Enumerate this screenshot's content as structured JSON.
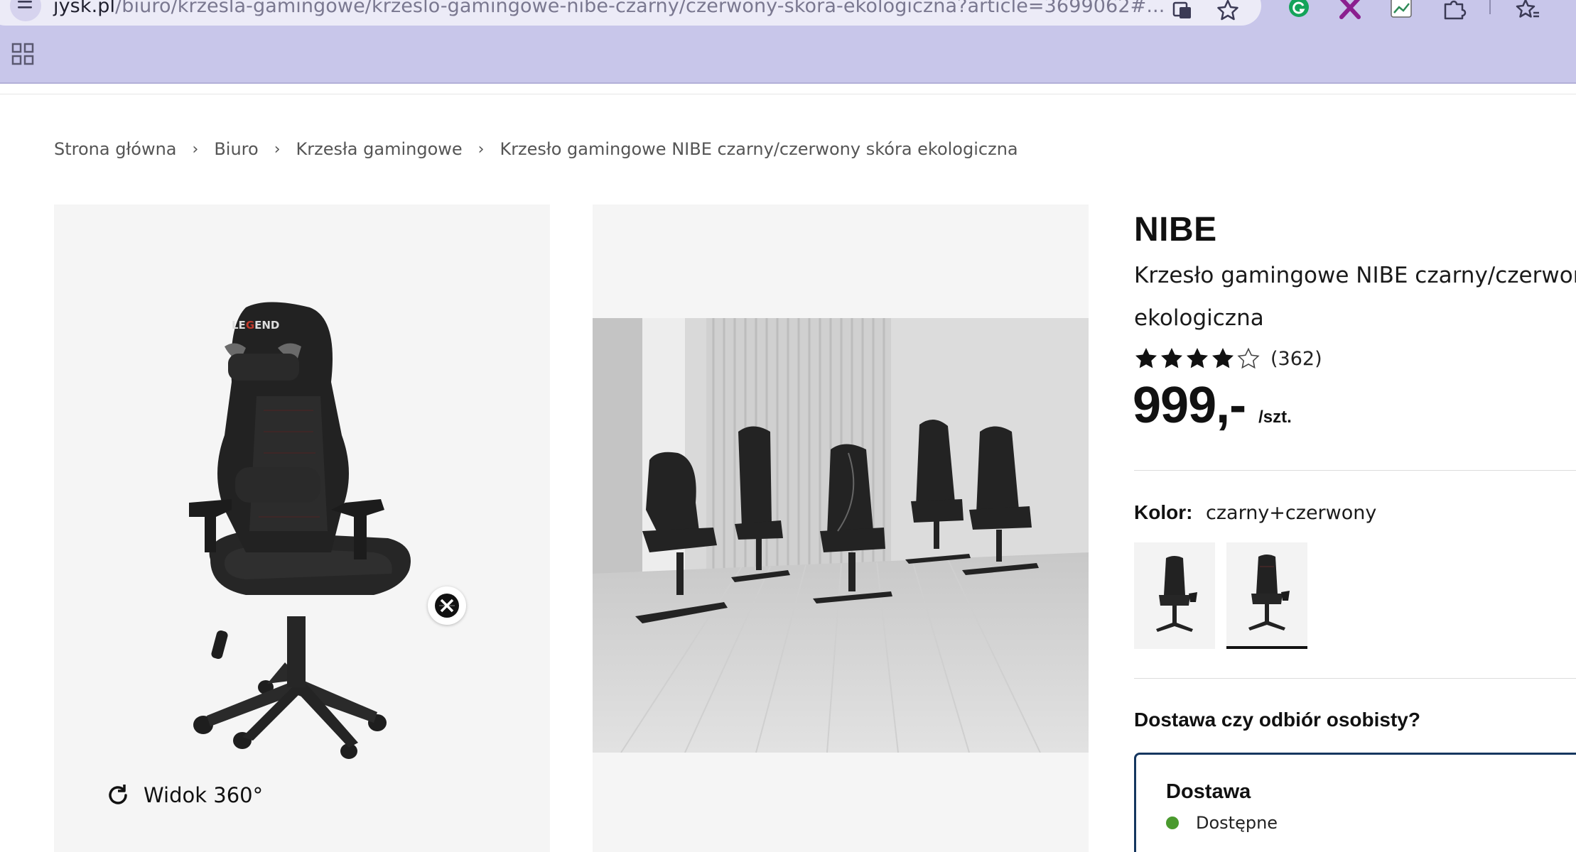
{
  "browser": {
    "url_host": "jysk.pl",
    "url_path": "/biuro/krzesla-gamingowe/krzeslo-gamingowe-nibe-czarny/czerwony-skora-ekologiczna?article=3699062#...",
    "icons": [
      "site-info-icon",
      "translate-icon",
      "bookmark-star-icon",
      "grammarly-icon",
      "x-extension-icon",
      "chart-extension-icon",
      "extensions-puzzle-icon",
      "reading-list-icon",
      "apps-grid-icon"
    ]
  },
  "breadcrumb": [
    "Strona główna",
    "Biuro",
    "Krzesła gamingowe",
    "Krzesło gamingowe NIBE czarny/czerwony skóra ekologiczna"
  ],
  "gallery": {
    "view360_label": "Widok 360°"
  },
  "product": {
    "brand": "NIBE",
    "subtitle_line1": "Krzesło gamingowe NIBE czarny/czerwony",
    "subtitle_line2": "ekologiczna",
    "rating": 4,
    "rating_max": 5,
    "rating_count": "(362)",
    "price": "999,-",
    "price_unit": "/szt.",
    "color_label": "Kolor:",
    "color_value": "czarny+czerwony",
    "delivery_question": "Dostawa czy odbiór osobisty?",
    "delivery_title": "Dostawa",
    "delivery_status": "Dostępne"
  },
  "colors": {
    "chrome": "#c8c6ea",
    "delivery_border": "#15365f",
    "available_dot": "#4a9a2e"
  }
}
